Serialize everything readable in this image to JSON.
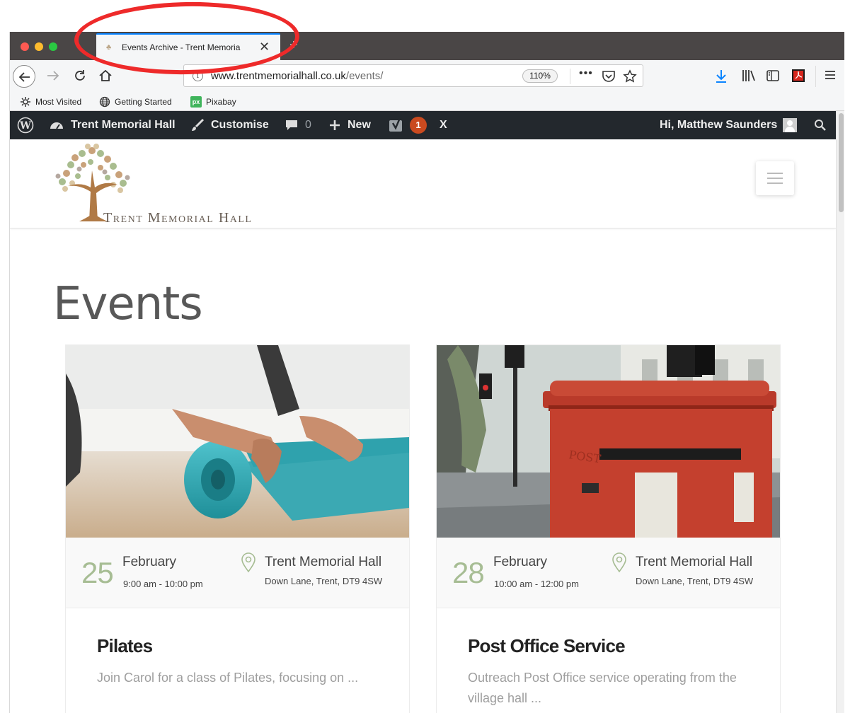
{
  "browser": {
    "tab": {
      "title": "Events Archive - Trent Memoria",
      "favicon": "tree-icon"
    },
    "url": {
      "host": "www.trentmemorialhall.co.uk",
      "path": "/events/",
      "zoom": "110%"
    },
    "bookmarks": [
      {
        "label": "Most Visited",
        "icon": "gear-icon"
      },
      {
        "label": "Getting Started",
        "icon": "globe-icon"
      },
      {
        "label": "Pixabay",
        "icon": "pixabay-icon",
        "icon_text": "px"
      }
    ]
  },
  "adminbar": {
    "site_name": "Trent Memorial Hall",
    "customise": "Customise",
    "comments_count": "0",
    "new_label": "New",
    "seo_count": "1",
    "close_label": "X",
    "greeting": "Hi, Matthew Saunders"
  },
  "site": {
    "logo_text": "Trent Memorial Hall"
  },
  "page": {
    "title": "Events"
  },
  "events": [
    {
      "day": "25",
      "month": "February",
      "time": "9:00 am - 10:00 pm",
      "venue": "Trent Memorial Hall",
      "address": "Down Lane, Trent, DT9 4SW",
      "title": "Pilates",
      "excerpt": "Join Carol for a class of Pilates, focusing on ..."
    },
    {
      "day": "28",
      "month": "February",
      "time": "10:00 am - 12:00 pm",
      "venue": "Trent Memorial Hall",
      "address": "Down Lane, Trent, DT9 4SW",
      "title": "Post Office Service",
      "excerpt": "Outreach Post Office service operating from the village hall ..."
    }
  ],
  "colors": {
    "accent_green": "#a7bd94",
    "adminbar": "#23282d",
    "annotation": "#ee2a2a",
    "tab_active": "#0a84ff"
  }
}
